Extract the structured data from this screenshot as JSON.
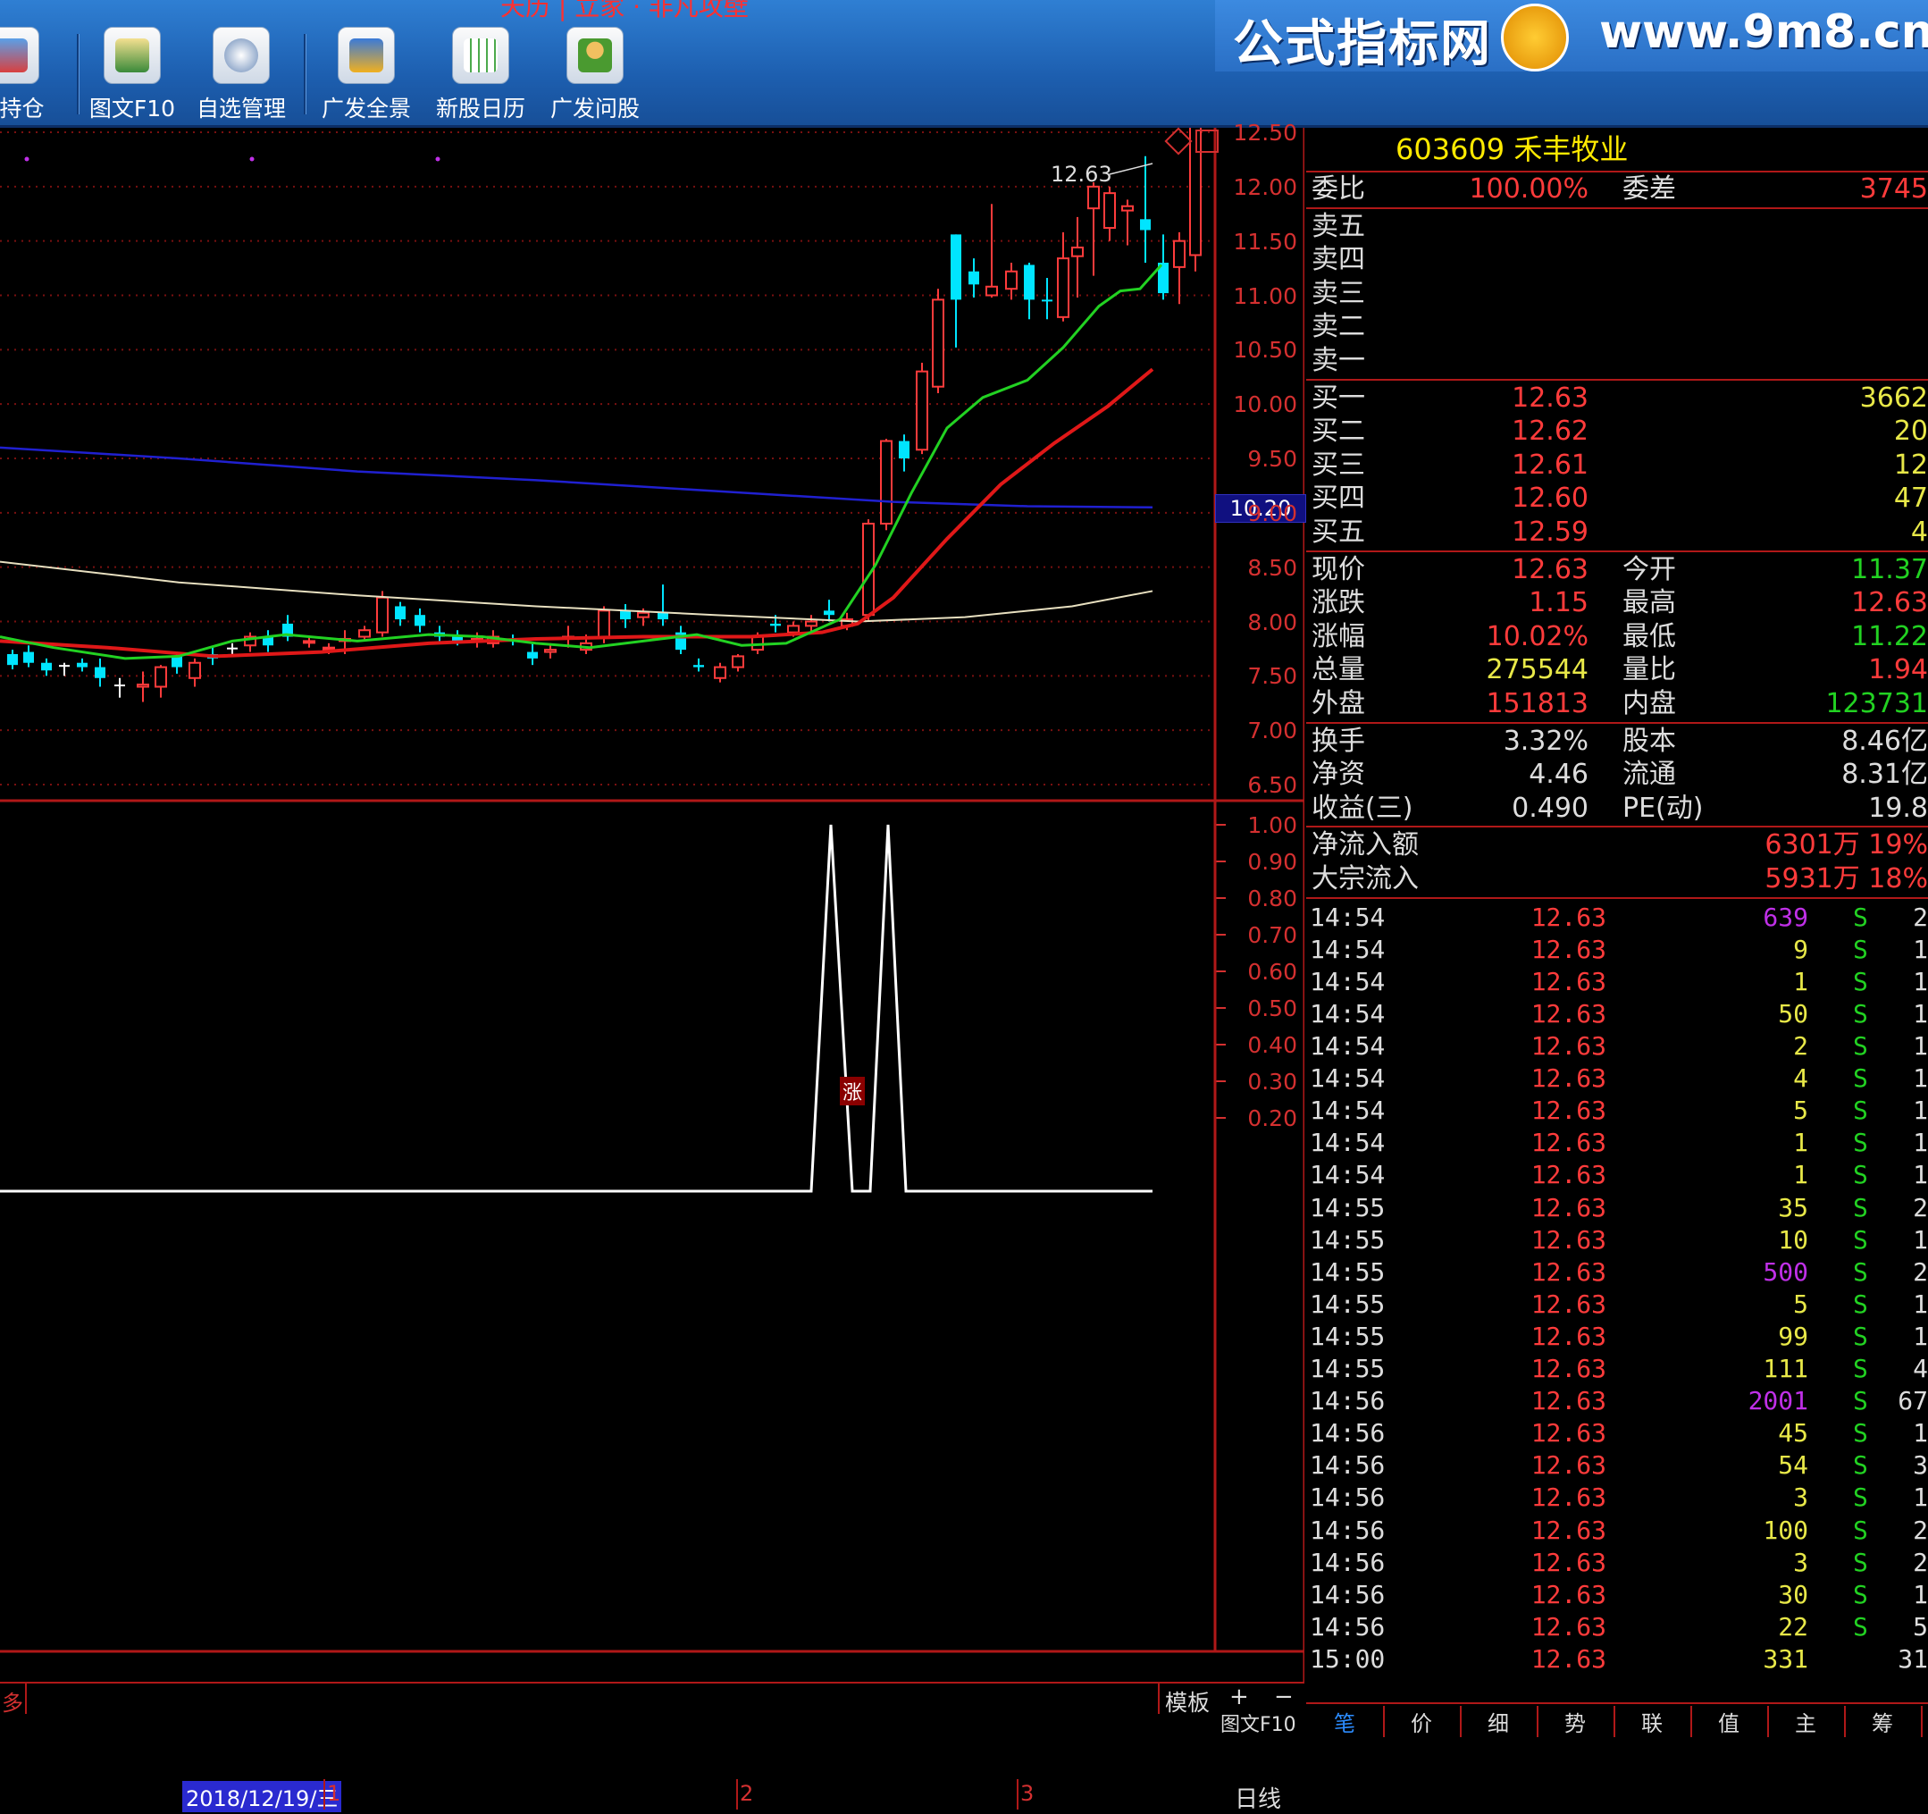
{
  "toolbar": {
    "title_partial": "天历 | 立家 · 非凡攻壁",
    "buttons": [
      {
        "label": "的持仓",
        "icon": "portfolio-icon"
      },
      {
        "label": "图文F10",
        "icon": "f10-icon"
      },
      {
        "label": "自选管理",
        "icon": "watchlist-icon"
      },
      {
        "label": "广发全景",
        "icon": "panorama-icon"
      },
      {
        "label": "新股日历",
        "icon": "calendar-icon"
      },
      {
        "label": "广发问股",
        "icon": "ask-icon"
      }
    ]
  },
  "watermark": {
    "cn": "公式指标网",
    "url": "www.9m8.cn"
  },
  "chart": {
    "price_axis": [
      "12.50",
      "12.00",
      "11.50",
      "11.00",
      "10.50",
      "10.00",
      "9.50",
      "9.00",
      "8.50",
      "8.00",
      "7.50",
      "7.00",
      "6.50"
    ],
    "current_price_marker": "10.20",
    "high_annotation": "12.63",
    "limit_up_marker": "涨",
    "indicator_axis": [
      "1.00",
      "0.90",
      "0.80",
      "0.70",
      "0.60",
      "0.50",
      "0.40",
      "0.30",
      "0.20"
    ],
    "selected_date": "2018/12/19/三",
    "period_markers": [
      "1",
      "2",
      "3"
    ],
    "period_label": "日线",
    "template_label": "模板",
    "zoom_in": "+",
    "zoom_out": "−",
    "status_left": "多",
    "f10_tab": "图文F10"
  },
  "quote": {
    "code": "603609",
    "name": "禾丰牧业",
    "weibi_label": "委比",
    "weibi": "100.00%",
    "weicha_label": "委差",
    "weicha": "3745",
    "sell": [
      {
        "label": "卖五",
        "price": "",
        "vol": ""
      },
      {
        "label": "卖四",
        "price": "",
        "vol": ""
      },
      {
        "label": "卖三",
        "price": "",
        "vol": ""
      },
      {
        "label": "卖二",
        "price": "",
        "vol": ""
      },
      {
        "label": "卖一",
        "price": "",
        "vol": ""
      }
    ],
    "buy": [
      {
        "label": "买一",
        "price": "12.63",
        "vol": "3662"
      },
      {
        "label": "买二",
        "price": "12.62",
        "vol": "20"
      },
      {
        "label": "买三",
        "price": "12.61",
        "vol": "12"
      },
      {
        "label": "买四",
        "price": "12.60",
        "vol": "47"
      },
      {
        "label": "买五",
        "price": "12.59",
        "vol": "4"
      }
    ],
    "stats1": [
      {
        "l1": "现价",
        "v1": "12.63",
        "l2": "今开",
        "v2": "11.37"
      },
      {
        "l1": "涨跌",
        "v1": "1.15",
        "l2": "最高",
        "v2": "12.63"
      },
      {
        "l1": "涨幅",
        "v1": "10.02%",
        "l2": "最低",
        "v2": "11.22"
      },
      {
        "l1": "总量",
        "v1": "275544",
        "l2": "量比",
        "v2": "1.94"
      },
      {
        "l1": "外盘",
        "v1": "151813",
        "l2": "内盘",
        "v2": "123731"
      }
    ],
    "stats2": [
      {
        "l1": "换手",
        "v1": "3.32%",
        "l2": "股本",
        "v2": "8.46亿"
      },
      {
        "l1": "净资",
        "v1": "4.46",
        "l2": "流通",
        "v2": "8.31亿"
      },
      {
        "l1": "收益(三)",
        "v1": "0.490",
        "l2": "PE(动)",
        "v2": "19.8"
      }
    ],
    "flows": [
      {
        "label": "净流入额",
        "value": "6301万",
        "pct": "19%"
      },
      {
        "label": "大宗流入",
        "value": "5931万",
        "pct": "18%"
      }
    ]
  },
  "ticks": [
    {
      "time": "14:54",
      "price": "12.63",
      "vol": "639",
      "color": "purple",
      "side": "S",
      "n": "2"
    },
    {
      "time": "14:54",
      "price": "12.63",
      "vol": "9",
      "color": "yellow",
      "side": "S",
      "n": "1"
    },
    {
      "time": "14:54",
      "price": "12.63",
      "vol": "1",
      "color": "yellow",
      "side": "S",
      "n": "1"
    },
    {
      "time": "14:54",
      "price": "12.63",
      "vol": "50",
      "color": "yellow",
      "side": "S",
      "n": "1"
    },
    {
      "time": "14:54",
      "price": "12.63",
      "vol": "2",
      "color": "yellow",
      "side": "S",
      "n": "1"
    },
    {
      "time": "14:54",
      "price": "12.63",
      "vol": "4",
      "color": "yellow",
      "side": "S",
      "n": "1"
    },
    {
      "time": "14:54",
      "price": "12.63",
      "vol": "5",
      "color": "yellow",
      "side": "S",
      "n": "1"
    },
    {
      "time": "14:54",
      "price": "12.63",
      "vol": "1",
      "color": "yellow",
      "side": "S",
      "n": "1"
    },
    {
      "time": "14:54",
      "price": "12.63",
      "vol": "1",
      "color": "yellow",
      "side": "S",
      "n": "1"
    },
    {
      "time": "14:55",
      "price": "12.63",
      "vol": "35",
      "color": "yellow",
      "side": "S",
      "n": "2"
    },
    {
      "time": "14:55",
      "price": "12.63",
      "vol": "10",
      "color": "yellow",
      "side": "S",
      "n": "1"
    },
    {
      "time": "14:55",
      "price": "12.63",
      "vol": "500",
      "color": "purple",
      "side": "S",
      "n": "2"
    },
    {
      "time": "14:55",
      "price": "12.63",
      "vol": "5",
      "color": "yellow",
      "side": "S",
      "n": "1"
    },
    {
      "time": "14:55",
      "price": "12.63",
      "vol": "99",
      "color": "yellow",
      "side": "S",
      "n": "1"
    },
    {
      "time": "14:55",
      "price": "12.63",
      "vol": "111",
      "color": "yellow",
      "side": "S",
      "n": "4"
    },
    {
      "time": "14:56",
      "price": "12.63",
      "vol": "2001",
      "color": "purple",
      "side": "S",
      "n": "67"
    },
    {
      "time": "14:56",
      "price": "12.63",
      "vol": "45",
      "color": "yellow",
      "side": "S",
      "n": "1"
    },
    {
      "time": "14:56",
      "price": "12.63",
      "vol": "54",
      "color": "yellow",
      "side": "S",
      "n": "3"
    },
    {
      "time": "14:56",
      "price": "12.63",
      "vol": "3",
      "color": "yellow",
      "side": "S",
      "n": "1"
    },
    {
      "time": "14:56",
      "price": "12.63",
      "vol": "100",
      "color": "yellow",
      "side": "S",
      "n": "2"
    },
    {
      "time": "14:56",
      "price": "12.63",
      "vol": "3",
      "color": "yellow",
      "side": "S",
      "n": "2"
    },
    {
      "time": "14:56",
      "price": "12.63",
      "vol": "30",
      "color": "yellow",
      "side": "S",
      "n": "1"
    },
    {
      "time": "14:56",
      "price": "12.63",
      "vol": "22",
      "color": "yellow",
      "side": "S",
      "n": "5"
    },
    {
      "time": "15:00",
      "price": "12.63",
      "vol": "331",
      "color": "yellow",
      "side": "",
      "n": "31"
    }
  ],
  "panel_tabs": [
    "笔",
    "价",
    "细",
    "势",
    "联",
    "值",
    "主",
    "筹"
  ],
  "colors": {
    "up": "#ff3b3b",
    "down": "#00e5ff",
    "ma5": "#22d222",
    "ma10": "#e01818",
    "ma60": "#2020d0",
    "ma120": "#e8e0c0",
    "grid": "#7a1010"
  }
}
